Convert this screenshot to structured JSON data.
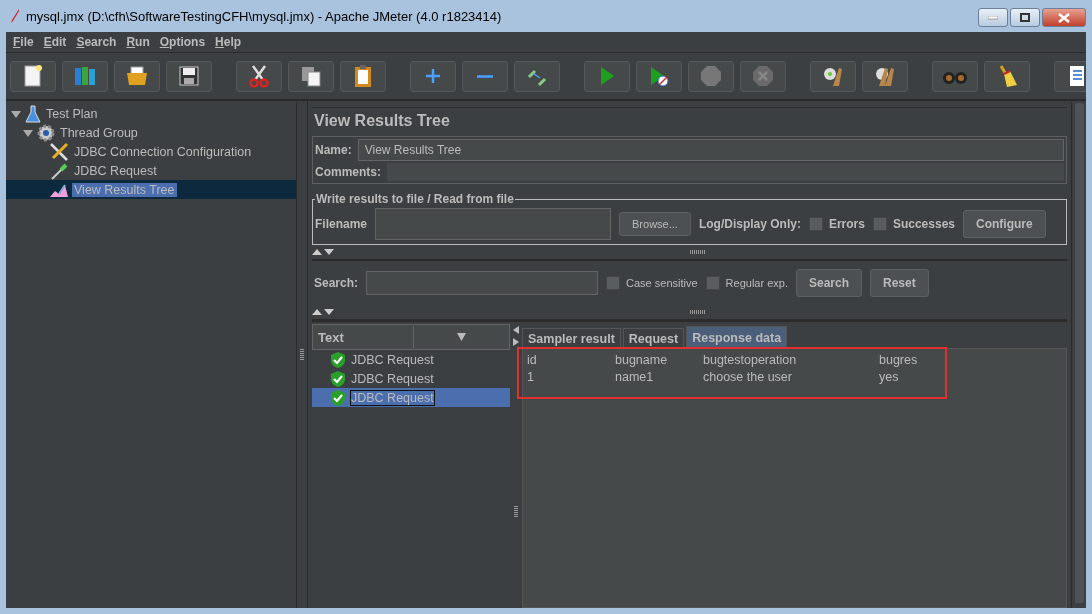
{
  "window": {
    "title": "mysql.jmx (D:\\cfh\\SoftwareTestingCFH\\mysql.jmx) - Apache JMeter (4.0 r1823414)"
  },
  "menu": [
    {
      "label": "File"
    },
    {
      "label": "Edit"
    },
    {
      "label": "Search"
    },
    {
      "label": "Run"
    },
    {
      "label": "Options"
    },
    {
      "label": "Help"
    }
  ],
  "tree": [
    {
      "label": "Test Plan",
      "kind": "plan",
      "expanded": true,
      "selected": false,
      "children": [
        {
          "label": "Thread Group",
          "kind": "group",
          "expanded": true,
          "selected": false,
          "children": [
            {
              "label": "JDBC Connection Configuration",
              "kind": "config",
              "selected": false
            },
            {
              "label": "JDBC Request",
              "kind": "sampler",
              "selected": false
            },
            {
              "label": "View Results Tree",
              "kind": "listener",
              "selected": true
            }
          ]
        }
      ]
    }
  ],
  "panel": {
    "title": "View Results Tree",
    "name_label": "Name:",
    "name_value": "View Results Tree",
    "comments_label": "Comments:",
    "file_group": {
      "legend": "Write results to file / Read from file",
      "filename_label": "Filename",
      "browse": "Browse...",
      "log_label": "Log/Display Only:",
      "errors": {
        "label": "Errors",
        "checked": false
      },
      "successes": {
        "label": "Successes",
        "checked": false
      },
      "configure": "Configure"
    },
    "search": {
      "label": "Search:",
      "case_sensitive": {
        "label": "Case sensitive",
        "checked": false
      },
      "regular_exp": {
        "label": "Regular exp.",
        "checked": false
      },
      "search_button": "Search",
      "reset_button": "Reset"
    },
    "renderer": "Text",
    "results": [
      {
        "label": "JDBC Request",
        "selected": false
      },
      {
        "label": "JDBC Request",
        "selected": false
      },
      {
        "label": "JDBC Request",
        "selected": true
      }
    ],
    "tabs": [
      {
        "label": "Sampler result",
        "selected": false
      },
      {
        "label": "Request",
        "selected": false
      },
      {
        "label": "Response data",
        "selected": true
      }
    ],
    "table": {
      "columns": [
        "id",
        "bugname",
        "bugtestoperation",
        "bugres"
      ],
      "rows": [
        [
          "1",
          "name1",
          "choose the user",
          "yes"
        ]
      ]
    }
  }
}
